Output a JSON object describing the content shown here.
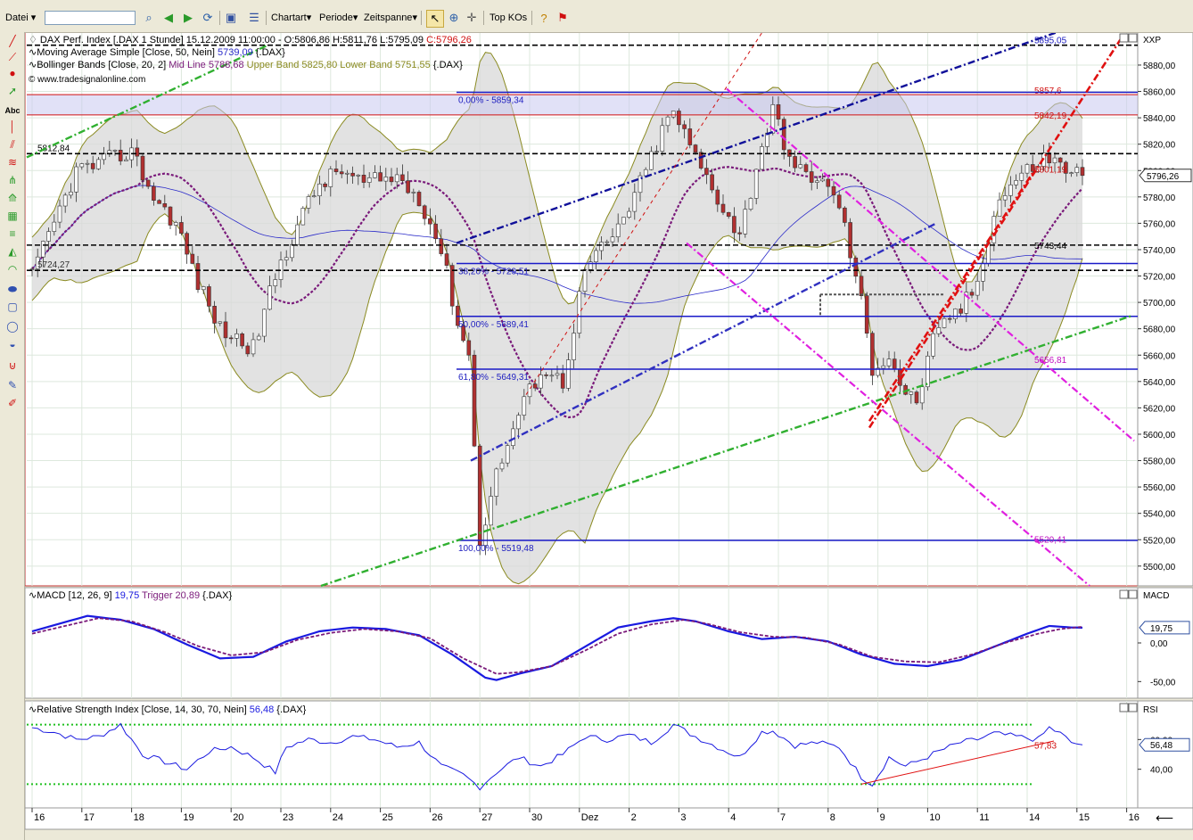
{
  "toolbar": {
    "menu_label": "Datei",
    "chart_type_label": "Chartart",
    "period_label": "Periode",
    "timespan_label": "Zeitspanne",
    "top_kos_label": "Top KOs",
    "search_value": ""
  },
  "side_toolbar": {
    "text_tool_label": "Abc"
  },
  "chart_data": [
    {
      "type": "candlestick",
      "panel": "price",
      "title": "DAX Perf. Index [.DAX  1 Stunde]",
      "header": {
        "timestamp": "15.12.2009 11:00:00",
        "ohlc": {
          "open_label": "O:5806,86",
          "high_label": "H:5811,76",
          "low_label": "L:5795,09",
          "close_label": "C:5796,26"
        }
      },
      "legend": [
        {
          "name": "Moving Average Simple [Close, 50, Nein]",
          "value": "5739,09",
          "suffix": "{.DAX}",
          "color": "#2b2bc9"
        },
        {
          "name": "Bollinger Bands [Close, 20, 2]",
          "mid_label": "Mid Line 5788,68",
          "upper_label": "Upper Band 5825,80",
          "lower_label": "Lower Band 5751,55",
          "suffix": "{.DAX}",
          "mid_color": "#7a1a7a",
          "band_color": "#8a8a20"
        }
      ],
      "source": "© www.tradesignalonline.com",
      "axis_label": "XXP",
      "ylim": [
        5485,
        5905
      ],
      "yticks": [
        5500,
        5520,
        5540,
        5560,
        5580,
        5600,
        5620,
        5640,
        5660,
        5680,
        5700,
        5720,
        5740,
        5760,
        5780,
        5800,
        5820,
        5840,
        5860,
        5880
      ],
      "ytick_labels": [
        "5500,00",
        "5520,00",
        "5540,00",
        "5560,00",
        "5580,00",
        "5600,00",
        "5620,00",
        "5640,00",
        "5660,00",
        "5680,00",
        "5700,00",
        "5720,00",
        "5740,00",
        "5760,00",
        "5780,00",
        "5800,00",
        "5820,00",
        "5840,00",
        "5860,00",
        "5880,00"
      ],
      "last_price_label": "5796,26",
      "x_labels": [
        "16",
        "17",
        "18",
        "19",
        "20",
        "23",
        "24",
        "25",
        "26",
        "27",
        "30",
        "Dez",
        "2",
        "3",
        "4",
        "7",
        "8",
        "9",
        "10",
        "11",
        "14",
        "15",
        "16"
      ],
      "x_bars": [
        0,
        9,
        18,
        27,
        36,
        45,
        54,
        63,
        72,
        81,
        90,
        99,
        108,
        117,
        126,
        135,
        144,
        153,
        162,
        171,
        180,
        189,
        198
      ],
      "n_bars": 200,
      "key_points": [
        [
          0,
          5720
        ],
        [
          4,
          5760
        ],
        [
          8,
          5800
        ],
        [
          12,
          5805
        ],
        [
          18,
          5815
        ],
        [
          22,
          5780
        ],
        [
          26,
          5760
        ],
        [
          30,
          5715
        ],
        [
          34,
          5680
        ],
        [
          40,
          5665
        ],
        [
          44,
          5720
        ],
        [
          48,
          5760
        ],
        [
          52,
          5790
        ],
        [
          56,
          5800
        ],
        [
          60,
          5790
        ],
        [
          66,
          5795
        ],
        [
          70,
          5780
        ],
        [
          74,
          5740
        ],
        [
          77,
          5685
        ],
        [
          79,
          5660
        ],
        [
          81,
          5520
        ],
        [
          84,
          5570
        ],
        [
          88,
          5615
        ],
        [
          92,
          5650
        ],
        [
          96,
          5640
        ],
        [
          100,
          5725
        ],
        [
          106,
          5755
        ],
        [
          110,
          5790
        ],
        [
          114,
          5830
        ],
        [
          116,
          5845
        ],
        [
          120,
          5810
        ],
        [
          124,
          5780
        ],
        [
          128,
          5750
        ],
        [
          132,
          5820
        ],
        [
          134,
          5845
        ],
        [
          138,
          5800
        ],
        [
          142,
          5795
        ],
        [
          146,
          5775
        ],
        [
          150,
          5700
        ],
        [
          152,
          5650
        ],
        [
          155,
          5660
        ],
        [
          158,
          5630
        ],
        [
          160,
          5625
        ],
        [
          163,
          5670
        ],
        [
          166,
          5690
        ],
        [
          168,
          5695
        ],
        [
          171,
          5715
        ],
        [
          174,
          5770
        ],
        [
          177,
          5790
        ],
        [
          180,
          5800
        ],
        [
          183,
          5810
        ],
        [
          186,
          5805
        ],
        [
          188,
          5800
        ],
        [
          190,
          5796.26
        ]
      ],
      "bollinger": {
        "upper_offset": 60,
        "lower_offset": 60
      },
      "horizontal_lines": [
        {
          "value": 5895.05,
          "label": "5895,05",
          "style": "dashed",
          "color": "#000000"
        },
        {
          "value": 5812.84,
          "label": "5812,84",
          "style": "dashed",
          "color": "#000000"
        },
        {
          "value": 5724.27,
          "label": "5724,27",
          "style": "dashed",
          "color": "#000000"
        },
        {
          "value": 5743.44,
          "label": "5743,44",
          "style": "dashed",
          "color": "#000000"
        },
        {
          "value": 5857.6,
          "label": "5857,6",
          "style": "solid",
          "color": "#d01010"
        },
        {
          "value": 5842.19,
          "label": "5842,19",
          "style": "solid",
          "color": "#d01010"
        }
      ],
      "fibonacci": [
        {
          "level": "0,00%",
          "value": 5859.34,
          "label": "0,00% - 5859,34"
        },
        {
          "level": "38,20%",
          "value": 5729.51,
          "label": "38,20% - 5729,51"
        },
        {
          "level": "50,00%",
          "value": 5689.41,
          "label": "50,00% - 5689,41"
        },
        {
          "level": "61,80%",
          "value": 5649.31,
          "label": "61,80% - 5649,31"
        },
        {
          "level": "100,00%",
          "value": 5519.48,
          "label": "100,00% - 5519,48"
        }
      ],
      "trendline_labels": [
        {
          "value": 5801.19,
          "label": "5801,19",
          "color": "#d01010"
        },
        {
          "value": 5656.81,
          "label": "5656,81",
          "color": "#c010c0"
        },
        {
          "value": 5520.41,
          "label": "5520,41",
          "color": "#c010c0"
        }
      ]
    },
    {
      "type": "line",
      "panel": "macd",
      "title": "MACD [12, 26, 9]",
      "macd_value": "19,75",
      "trigger_label": "Trigger 20,89",
      "suffix": "{.DAX}",
      "axis_label": "MACD",
      "ylim": [
        -60,
        60
      ],
      "yticks": [
        0,
        -50
      ],
      "ytick_labels": [
        "0,00",
        "-50,00"
      ],
      "last_value_label": "19,75",
      "series": [
        {
          "name": "MACD",
          "color": "#1a1ae0",
          "points": [
            [
              0,
              15
            ],
            [
              5,
              25
            ],
            [
              10,
              35
            ],
            [
              16,
              30
            ],
            [
              22,
              18
            ],
            [
              28,
              -2
            ],
            [
              34,
              -20
            ],
            [
              40,
              -18
            ],
            [
              46,
              2
            ],
            [
              52,
              15
            ],
            [
              58,
              20
            ],
            [
              64,
              18
            ],
            [
              70,
              10
            ],
            [
              76,
              -15
            ],
            [
              82,
              -45
            ],
            [
              84,
              -48
            ],
            [
              88,
              -40
            ],
            [
              94,
              -30
            ],
            [
              100,
              -5
            ],
            [
              106,
              20
            ],
            [
              112,
              28
            ],
            [
              116,
              32
            ],
            [
              120,
              28
            ],
            [
              126,
              15
            ],
            [
              132,
              5
            ],
            [
              138,
              8
            ],
            [
              144,
              2
            ],
            [
              150,
              -15
            ],
            [
              156,
              -27
            ],
            [
              162,
              -30
            ],
            [
              168,
              -22
            ],
            [
              174,
              -5
            ],
            [
              180,
              12
            ],
            [
              184,
              22
            ],
            [
              188,
              20
            ],
            [
              190,
              19.75
            ]
          ]
        },
        {
          "name": "Trigger",
          "color": "#7a1a7a",
          "dashed": true,
          "points": [
            [
              0,
              12
            ],
            [
              6,
              22
            ],
            [
              12,
              32
            ],
            [
              18,
              28
            ],
            [
              24,
              14
            ],
            [
              30,
              -4
            ],
            [
              36,
              -16
            ],
            [
              42,
              -12
            ],
            [
              48,
              4
            ],
            [
              54,
              13
            ],
            [
              60,
              18
            ],
            [
              66,
              15
            ],
            [
              72,
              6
            ],
            [
              78,
              -20
            ],
            [
              84,
              -40
            ],
            [
              88,
              -38
            ],
            [
              94,
              -30
            ],
            [
              100,
              -10
            ],
            [
              106,
              12
            ],
            [
              112,
              24
            ],
            [
              118,
              30
            ],
            [
              122,
              25
            ],
            [
              128,
              14
            ],
            [
              134,
              8
            ],
            [
              140,
              7
            ],
            [
              146,
              -2
            ],
            [
              152,
              -18
            ],
            [
              158,
              -24
            ],
            [
              164,
              -25
            ],
            [
              170,
              -15
            ],
            [
              176,
              0
            ],
            [
              182,
              12
            ],
            [
              186,
              18
            ],
            [
              190,
              20.89
            ]
          ]
        }
      ]
    },
    {
      "type": "line",
      "panel": "rsi",
      "title": "Relative Strength Index [Close, 14, 30, 70, Nein]",
      "rsi_value": "56,48",
      "suffix": "{.DAX}",
      "axis_label": "RSI",
      "ylim": [
        20,
        80
      ],
      "yticks": [
        60,
        40
      ],
      "ytick_labels": [
        "60,00",
        "40,00"
      ],
      "last_value_label": "56,48",
      "overbought": 70,
      "oversold": 30,
      "trend_label": "57,83",
      "series": [
        {
          "name": "RSI",
          "color": "#1a1ae0",
          "points": [
            [
              0,
              68
            ],
            [
              4,
              65
            ],
            [
              8,
              60
            ],
            [
              12,
              62
            ],
            [
              16,
              70
            ],
            [
              20,
              50
            ],
            [
              24,
              45
            ],
            [
              28,
              40
            ],
            [
              32,
              52
            ],
            [
              36,
              55
            ],
            [
              40,
              48
            ],
            [
              44,
              38
            ],
            [
              46,
              55
            ],
            [
              50,
              60
            ],
            [
              54,
              58
            ],
            [
              58,
              62
            ],
            [
              62,
              60
            ],
            [
              66,
              55
            ],
            [
              70,
              58
            ],
            [
              74,
              42
            ],
            [
              78,
              36
            ],
            [
              81,
              28
            ],
            [
              84,
              38
            ],
            [
              88,
              48
            ],
            [
              92,
              42
            ],
            [
              96,
              50
            ],
            [
              100,
              62
            ],
            [
              104,
              60
            ],
            [
              108,
              63
            ],
            [
              112,
              58
            ],
            [
              116,
              70
            ],
            [
              120,
              62
            ],
            [
              124,
              55
            ],
            [
              128,
              48
            ],
            [
              132,
              65
            ],
            [
              134,
              66
            ],
            [
              138,
              56
            ],
            [
              142,
              58
            ],
            [
              146,
              55
            ],
            [
              150,
              35
            ],
            [
              152,
              30
            ],
            [
              155,
              48
            ],
            [
              158,
              42
            ],
            [
              160,
              45
            ],
            [
              164,
              52
            ],
            [
              168,
              58
            ],
            [
              171,
              60
            ],
            [
              174,
              64
            ],
            [
              178,
              62
            ],
            [
              182,
              60
            ],
            [
              184,
              68
            ],
            [
              186,
              64
            ],
            [
              188,
              58
            ],
            [
              190,
              56.48
            ]
          ]
        }
      ]
    }
  ]
}
